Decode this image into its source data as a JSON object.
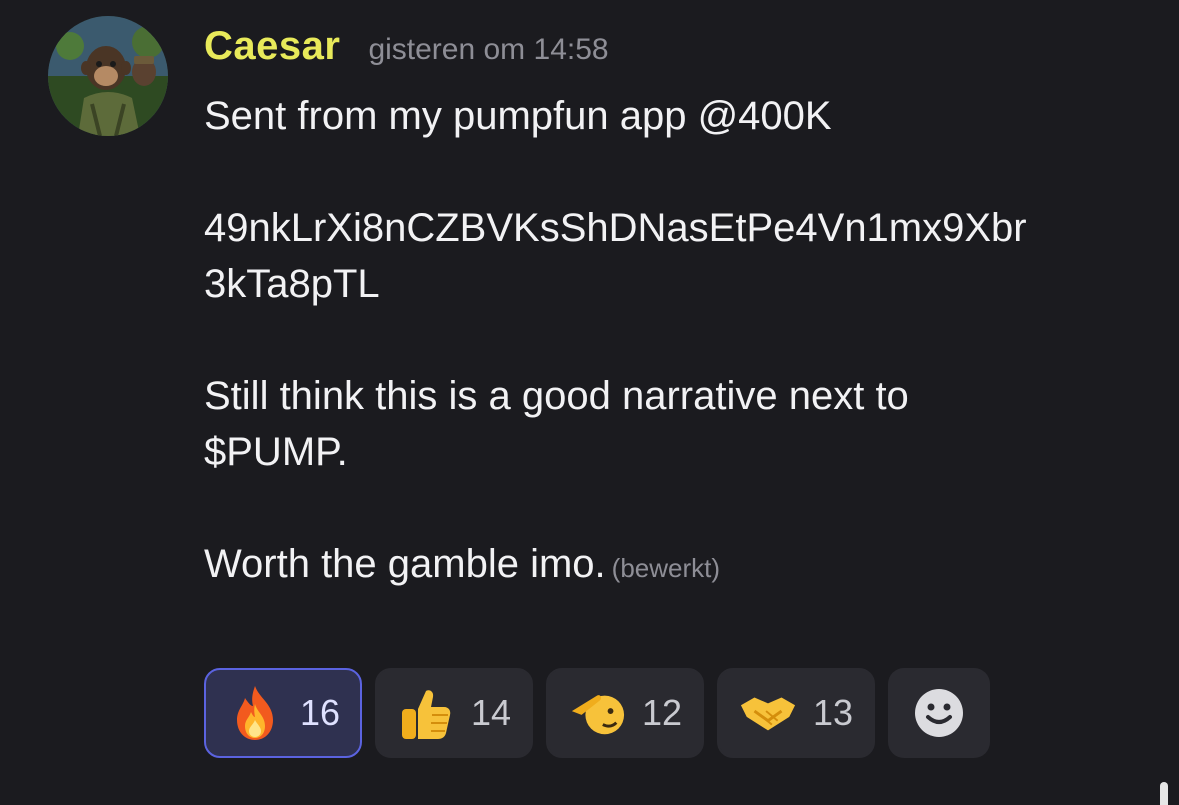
{
  "message": {
    "author": "Caesar",
    "timestamp": "gisteren om 14:58",
    "author_color": "#e8ea5a",
    "avatar_icon": "monkey-soldier-avatar",
    "lines": [
      "Sent from my pumpfun app @400K",
      "",
      "49nkLrXi8nCZBVKsShDNasEtPe4Vn1mx9Xbr",
      "3kTa8pTL",
      "",
      "Still think this is a good narrative next to",
      "$PUMP.",
      "",
      "Worth the gamble imo."
    ],
    "edited_label": "(bewerkt)"
  },
  "reactions": [
    {
      "emoji": "fire",
      "count": "16",
      "selected": true
    },
    {
      "emoji": "thumbs-up",
      "count": "14",
      "selected": false
    },
    {
      "emoji": "saluting-face",
      "count": "12",
      "selected": false
    },
    {
      "emoji": "handshake",
      "count": "13",
      "selected": false
    }
  ],
  "add_reaction_icon": "smiley-add-reaction-icon",
  "colors": {
    "background": "#1b1b1f",
    "text": "#f2f2f4",
    "muted": "#8e8e96",
    "reaction_bg": "#2a2a30",
    "reaction_selected_border": "#5b63e0"
  }
}
